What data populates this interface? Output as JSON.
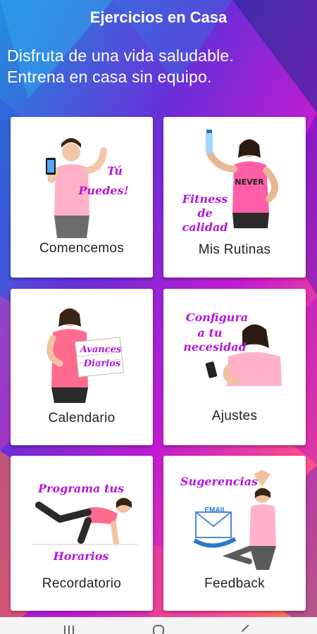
{
  "header": {
    "title": "Ejercicios en Casa"
  },
  "tagline": {
    "line1": "Disfruta de una vida saludable.",
    "line2": "Entrena en casa sin equipo."
  },
  "cards": [
    {
      "label": "Comencemos",
      "overlay": [
        "Tú",
        "Puedes!"
      ]
    },
    {
      "label": "Mis Rutinas",
      "overlay": [
        "Fitness",
        "de",
        "calidad"
      ]
    },
    {
      "label": "Calendario",
      "overlay": [
        "Avances",
        "Diarios"
      ]
    },
    {
      "label": "Ajustes",
      "overlay": [
        "Configura",
        "a tu",
        "necesidad"
      ]
    },
    {
      "label": "Recordatorio",
      "overlay": [
        "Programa tus",
        "Horarios"
      ]
    },
    {
      "label": "Feedback",
      "overlay": [
        "Sugerencias",
        "EMAIL"
      ]
    }
  ],
  "navbar": {
    "icons": [
      "recent-apps-icon",
      "home-icon",
      "back-icon"
    ]
  },
  "colors": {
    "accent_script": "#b417d9",
    "shirt_pink": "#ff5fa8",
    "background_gradient": [
      "#1f8fe0",
      "#6a2ed8",
      "#c41bd2",
      "#ff4f8b",
      "#ff8a3d"
    ]
  }
}
